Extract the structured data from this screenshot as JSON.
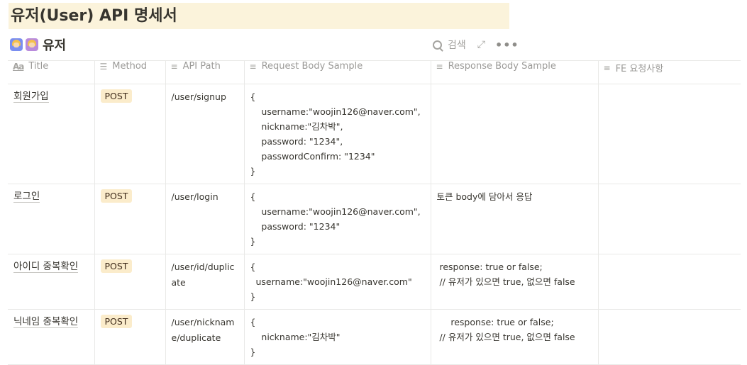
{
  "page": {
    "title": "유저(User)  API 명세서"
  },
  "database": {
    "title": "유저",
    "search_label": "검색",
    "more_label": "•••"
  },
  "columns": [
    {
      "label": "Title",
      "icon": "title-text-icon"
    },
    {
      "label": "Method",
      "icon": "list-icon"
    },
    {
      "label": "API Path",
      "icon": "text-lines-icon"
    },
    {
      "label": "Request Body Sample",
      "icon": "text-lines-icon"
    },
    {
      "label": "Response Body Sample",
      "icon": "text-lines-icon"
    },
    {
      "label": "FE 요청사항",
      "icon": "text-lines-icon"
    }
  ],
  "rows": [
    {
      "title": "회원가입",
      "method": "POST",
      "path": "/user/signup",
      "request": [
        "{",
        "    username:\"woojin126@naver.com\",",
        "    nickname:\"김차박\",",
        "    password: \"1234\",",
        "    passwordConfirm: \"1234\"",
        "}"
      ],
      "response": [],
      "fe": ""
    },
    {
      "title": "로그인",
      "method": "POST",
      "path": "/user/login",
      "request": [
        "{",
        "    username:\"woojin126@naver.com\",",
        "    password: \"1234\"",
        "}"
      ],
      "response": [
        "토큰 body에 담아서 응답"
      ],
      "fe": ""
    },
    {
      "title": "아이디 중복확인",
      "method": "POST",
      "path": "/user/id/duplicate",
      "request": [
        "{",
        "  username:\"woojin126@naver.com\"",
        "}"
      ],
      "response": [
        " response: true or false;",
        " // 유저가 있으면 true, 없으면 false"
      ],
      "fe": ""
    },
    {
      "title": "닉네임 중복확인",
      "method": "POST",
      "path": "/user/nickname/duplicate",
      "request": [
        "{",
        "    nickname:\"김차박\"",
        "}"
      ],
      "response": [
        "     response: true or false;",
        " // 유저가 있으면 true, 없으면 false"
      ],
      "fe": ""
    }
  ],
  "colors": {
    "title_highlight": "#fbf3db",
    "method_badge": "#fbeccb",
    "border": "#e9e9e7"
  }
}
